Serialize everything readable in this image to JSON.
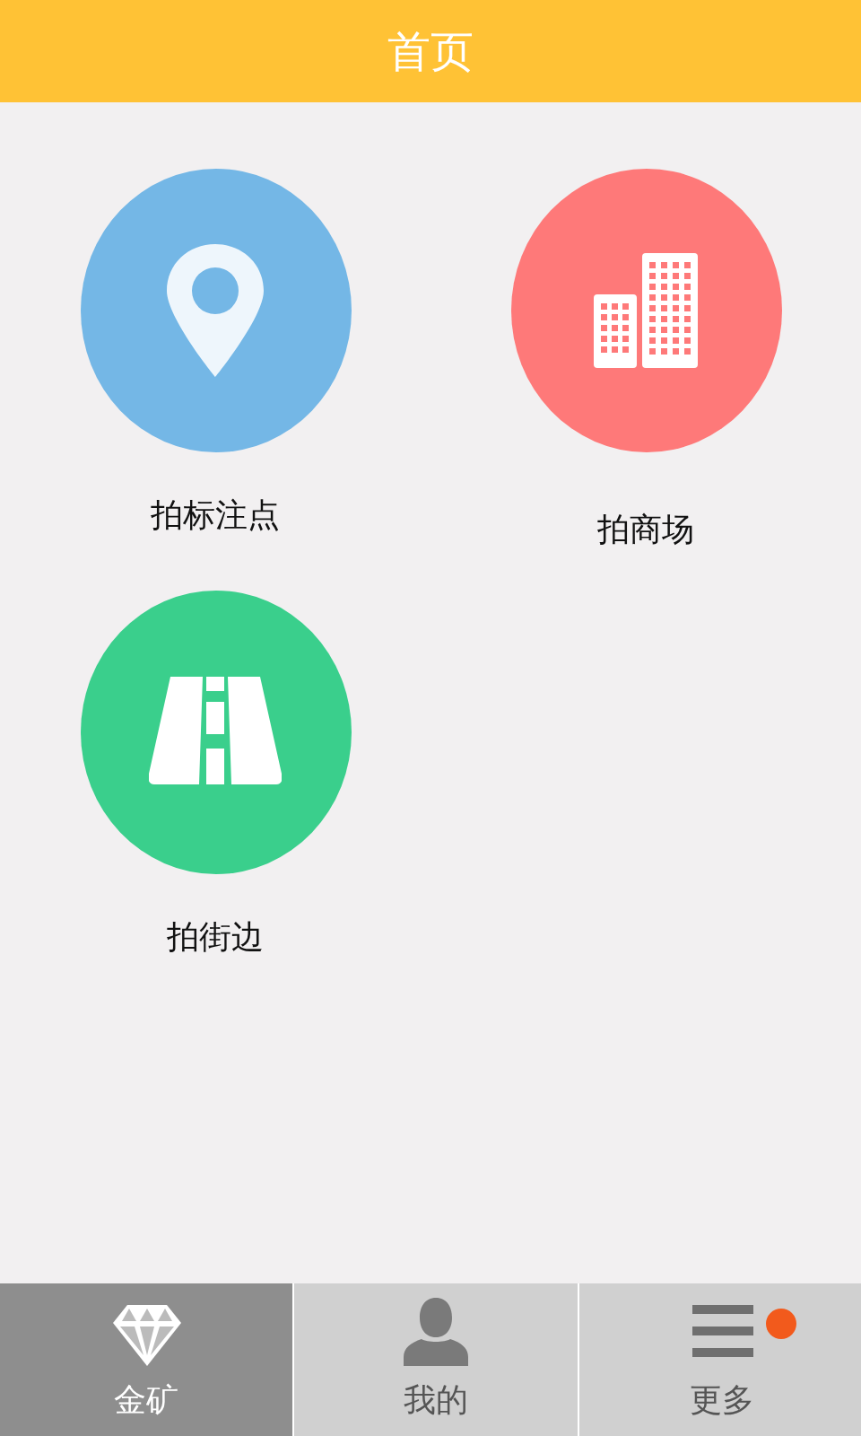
{
  "header": {
    "title": "首页"
  },
  "tiles": [
    {
      "label": "拍标注点",
      "kind": "pin",
      "color": "#74b7e6"
    },
    {
      "label": "拍商场",
      "kind": "buildings",
      "color": "#fe7979"
    },
    {
      "label": "拍街边",
      "kind": "road",
      "color": "#3acf8c"
    }
  ],
  "tab_bar": [
    {
      "label": "金矿",
      "kind": "diamond",
      "selected": true,
      "badge": false
    },
    {
      "label": "我的",
      "kind": "person",
      "selected": false,
      "badge": false
    },
    {
      "label": "更多",
      "kind": "more",
      "selected": false,
      "badge": true
    }
  ]
}
